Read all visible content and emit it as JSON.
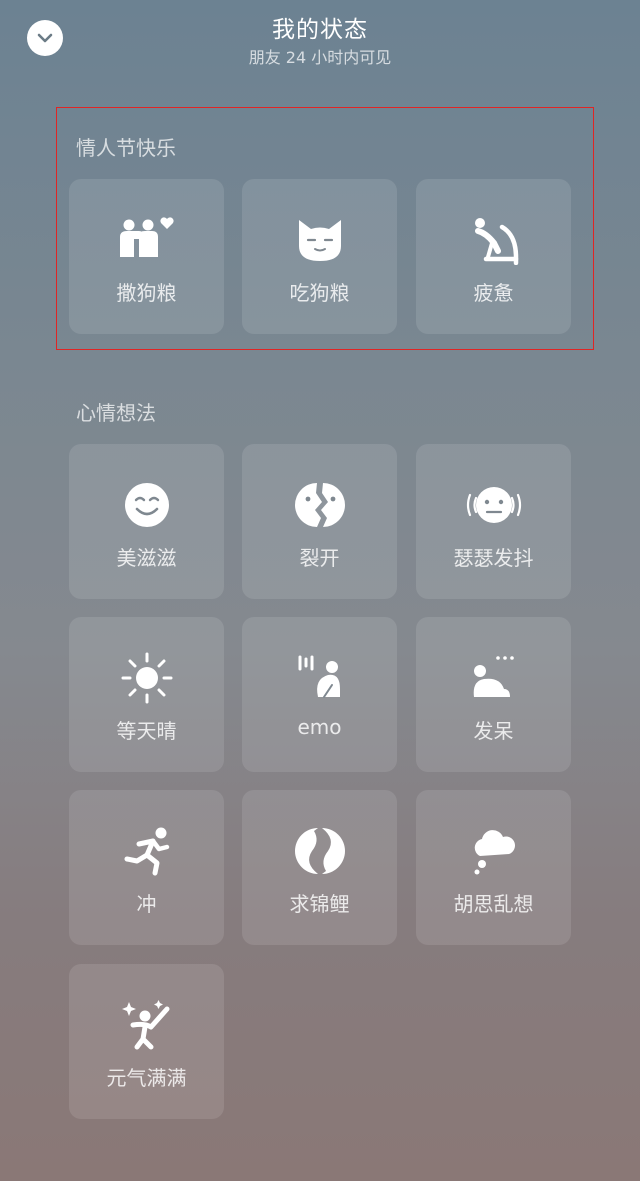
{
  "header": {
    "title": "我的状态",
    "subtitle": "朋友 24 小时内可见"
  },
  "sections": [
    {
      "title": "情人节快乐",
      "items": [
        {
          "label": "撒狗粮",
          "icon": "couple-heart-icon"
        },
        {
          "label": "吃狗粮",
          "icon": "cat-face-icon"
        },
        {
          "label": "疲惫",
          "icon": "slumped-person-icon"
        }
      ]
    },
    {
      "title": "心情想法",
      "items": [
        {
          "label": "美滋滋",
          "icon": "smile-face-icon"
        },
        {
          "label": "裂开",
          "icon": "split-face-icon"
        },
        {
          "label": "瑟瑟发抖",
          "icon": "shivering-face-icon"
        },
        {
          "label": "等天晴",
          "icon": "sun-icon"
        },
        {
          "label": "emo",
          "icon": "crouching-person-icon"
        },
        {
          "label": "发呆",
          "icon": "sitting-person-icon"
        },
        {
          "label": "冲",
          "icon": "running-person-icon"
        },
        {
          "label": "求锦鲤",
          "icon": "koi-icon"
        },
        {
          "label": "胡思乱想",
          "icon": "thought-cloud-icon"
        },
        {
          "label": "元气满满",
          "icon": "energetic-person-icon"
        }
      ]
    }
  ],
  "colors": {
    "highlight_border": "#e02525",
    "icon_fill": "#ffffff"
  }
}
